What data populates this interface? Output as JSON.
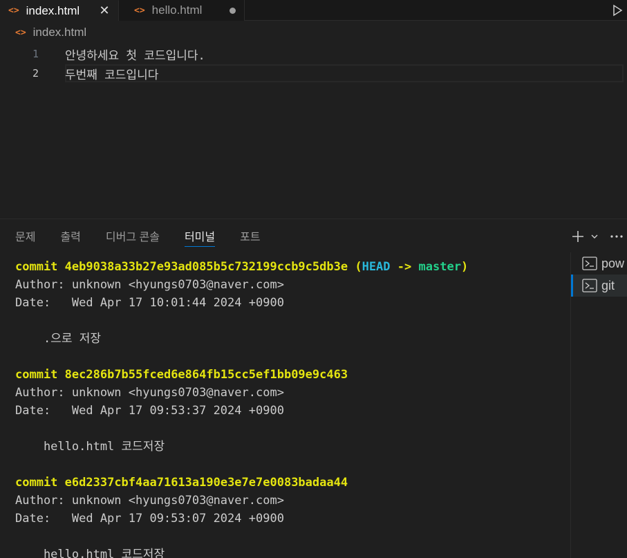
{
  "tabs": [
    {
      "label": "index.html",
      "icon": "html-icon",
      "active": true,
      "close": "✕"
    },
    {
      "label": "hello.html",
      "icon": "html-icon",
      "active": false,
      "dirty": true
    }
  ],
  "breadcrumb": {
    "icon": "html-icon",
    "file": "index.html"
  },
  "editor": {
    "lines": [
      {
        "number": "1",
        "text": "안녕하세요 첫 코드입니다."
      },
      {
        "number": "2",
        "text": "두번째 코드입니다"
      }
    ],
    "current_line": "2"
  },
  "panel": {
    "tabs": [
      "문제",
      "출력",
      "디버그 콘솔",
      "터미널",
      "포트"
    ],
    "active_tab": "터미널",
    "actions": [
      "plus-icon",
      "chevron-down-icon",
      "more-icon"
    ]
  },
  "terminal": {
    "commits": [
      {
        "commit_label": "commit",
        "hash": "4eb9038a33b27e93ad085b5c732199ccb9c5db3e",
        "ref_open": "(",
        "head": "HEAD",
        "arrow": "->",
        "branch": "master",
        "ref_close": ")",
        "author": "Author: unknown <hyungs0703@naver.com>",
        "date": "Date:   Wed Apr 17 10:01:44 2024 +0900",
        "message": "    .으로 저장"
      },
      {
        "commit_label": "commit",
        "hash": "8ec286b7b55fced6e864fb15cc5ef1bb09e9c463",
        "author": "Author: unknown <hyungs0703@naver.com>",
        "date": "Date:   Wed Apr 17 09:53:37 2024 +0900",
        "message": "    hello.html 코드저장"
      },
      {
        "commit_label": "commit",
        "hash": "e6d2337cbf4aa71613a190e3e7e7e0083badaa44",
        "author": "Author: unknown <hyungs0703@naver.com>",
        "date": "Date:   Wed Apr 17 09:53:07 2024 +0900",
        "message": "    hello.html 코드저장"
      }
    ]
  },
  "terminal_list": [
    {
      "label": "pow",
      "icon": "terminal-icon",
      "active": false
    },
    {
      "label": "git",
      "icon": "terminal-icon",
      "active": true
    }
  ],
  "colors": {
    "background": "#1f1f1f",
    "accent": "#0078d4",
    "commit_yellow": "#e5e510",
    "head_cyan": "#29b8db",
    "branch_green": "#23d18b",
    "html_icon_orange": "#e37933"
  }
}
